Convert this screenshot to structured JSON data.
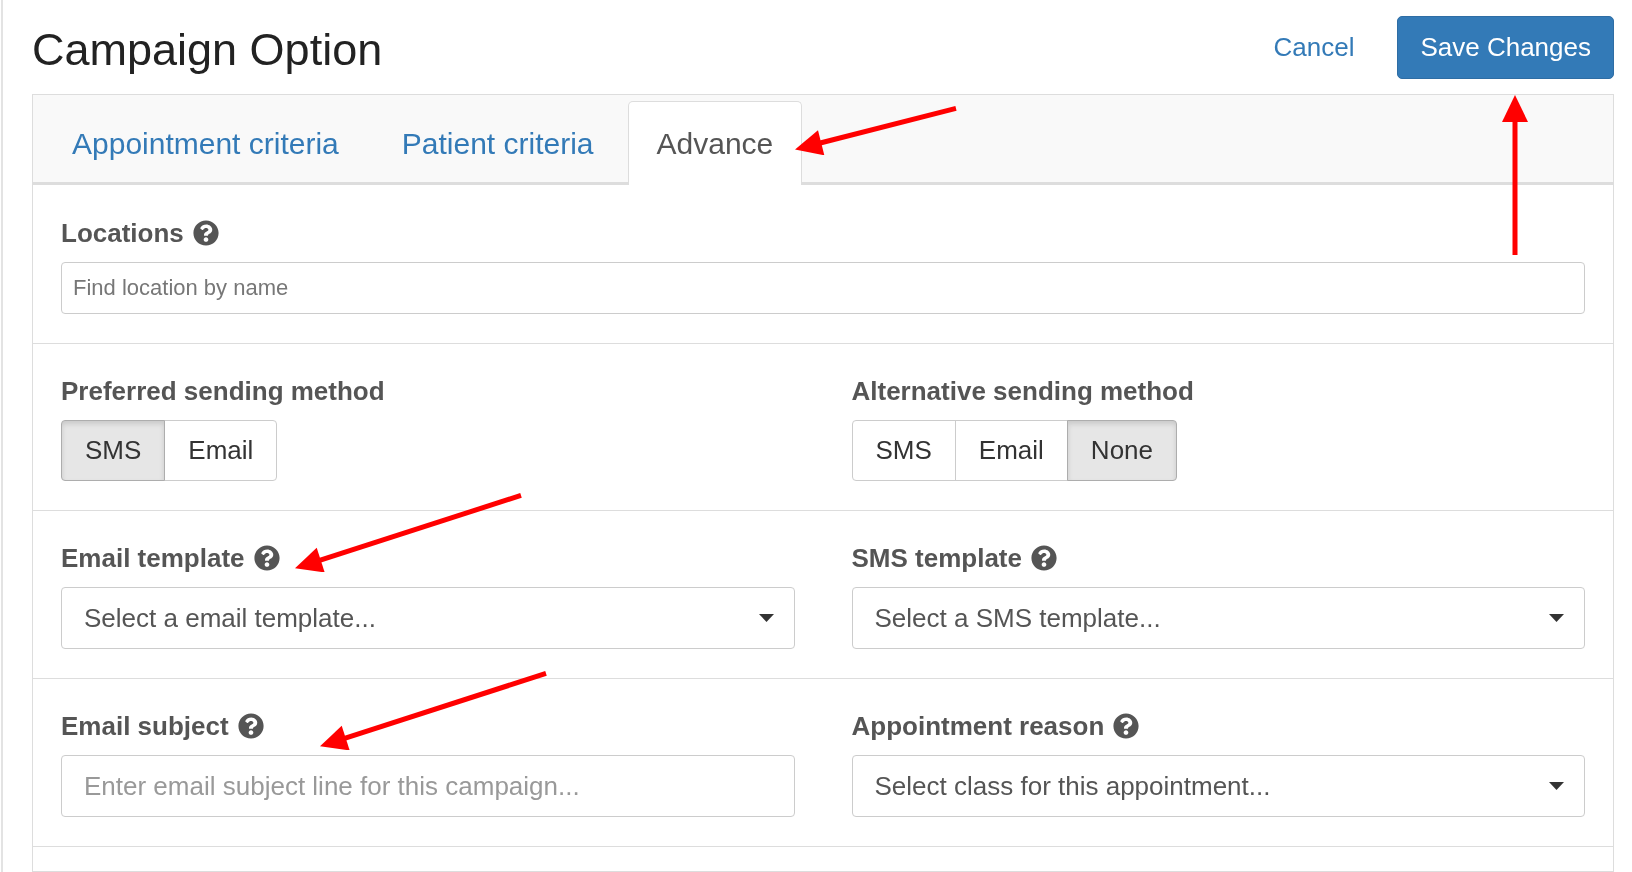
{
  "header": {
    "title": "Campaign Option",
    "cancel": "Cancel",
    "save": "Save Changes"
  },
  "tabs": [
    {
      "label": "Appointment criteria",
      "selected": false
    },
    {
      "label": "Patient criteria",
      "selected": false
    },
    {
      "label": "Advance",
      "selected": true
    }
  ],
  "sections": [
    {
      "fields": [
        {
          "kind": "tag_input",
          "label": "Locations",
          "help": true,
          "placeholder": "Find location by name"
        }
      ]
    },
    {
      "fields": [
        {
          "kind": "segmented",
          "label": "Preferred sending method",
          "options": [
            {
              "label": "SMS",
              "selected": true
            },
            {
              "label": "Email",
              "selected": false
            }
          ]
        },
        {
          "kind": "segmented",
          "label": "Alternative sending method",
          "options": [
            {
              "label": "SMS",
              "selected": false
            },
            {
              "label": "Email",
              "selected": false
            },
            {
              "label": "None",
              "selected": true
            }
          ]
        }
      ]
    },
    {
      "fields": [
        {
          "kind": "select",
          "label": "Email template",
          "help": true,
          "placeholder": "Select a email template..."
        },
        {
          "kind": "select",
          "label": "SMS template",
          "help": true,
          "placeholder": "Select a SMS template..."
        }
      ]
    },
    {
      "fields": [
        {
          "kind": "input",
          "label": "Email subject",
          "help": true,
          "placeholder": "Enter email subject line for this campaign..."
        },
        {
          "kind": "select",
          "label": "Appointment reason",
          "help": true,
          "placeholder": "Select class for this appointment..."
        }
      ]
    }
  ],
  "annotations": [
    {
      "kind": "arrow"
    },
    {
      "kind": "arrow"
    },
    {
      "kind": "arrow"
    },
    {
      "kind": "arrow"
    }
  ]
}
